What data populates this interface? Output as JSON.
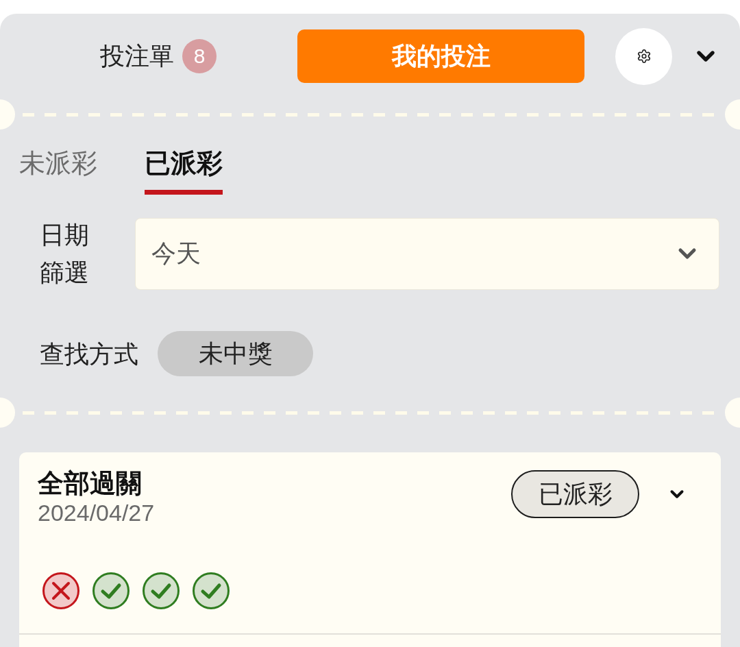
{
  "header": {
    "title": "投注單",
    "badge": "8",
    "button": "我的投注"
  },
  "tabs": [
    {
      "label": "未派彩",
      "selected": false
    },
    {
      "label": "已派彩",
      "selected": true
    }
  ],
  "date_filter": {
    "label": "日期篩選",
    "value": "今天"
  },
  "search_mode": {
    "label": "查找方式",
    "value": "未中獎"
  },
  "bets": [
    {
      "title": "全部過關",
      "date": "2024/04/27",
      "status": "已派彩",
      "legs": [
        {
          "won": false
        },
        {
          "won": true
        },
        {
          "won": true
        },
        {
          "won": true
        }
      ]
    }
  ]
}
